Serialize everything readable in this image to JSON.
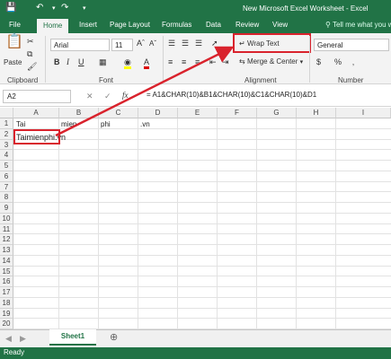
{
  "window": {
    "title": "New Microsoft Excel Worksheet - Excel"
  },
  "ribbon_tabs": [
    "File",
    "Home",
    "Insert",
    "Page Layout",
    "Formulas",
    "Data",
    "Review",
    "View"
  ],
  "tell_me": "Tell me what you w",
  "ribbon": {
    "paste_label": "Paste",
    "font_name": "Arial",
    "font_size": "11",
    "wrap_text_label": "Wrap Text",
    "merge_center_label": "Merge & Center",
    "number_format": "General",
    "groups": {
      "clipboard": "Clipboard",
      "font": "Font",
      "alignment": "Alignment",
      "number": "Number"
    }
  },
  "formula_bar": {
    "cell_ref": "A2",
    "formula": "= A1&CHAR(10)&B1&CHAR(10)&C1&CHAR(10)&D1",
    "fx_label": "fx"
  },
  "grid": {
    "columns": [
      "A",
      "B",
      "C",
      "D",
      "E",
      "F",
      "G",
      "H",
      "I"
    ],
    "rows": [
      "1",
      "2",
      "3",
      "4",
      "5",
      "6",
      "7",
      "8",
      "9",
      "10",
      "11",
      "12",
      "13",
      "14",
      "15",
      "16",
      "17",
      "18",
      "19",
      "20"
    ],
    "cells": {
      "A1": "Tai",
      "B1": "mien",
      "C1": "phi",
      "D1": ".vn",
      "A2": "Taimienphi.vn"
    }
  },
  "sheets": [
    "Sheet1"
  ],
  "status": "Ready",
  "colors": {
    "excel_green": "#217346",
    "highlight_red": "#d9232d"
  }
}
